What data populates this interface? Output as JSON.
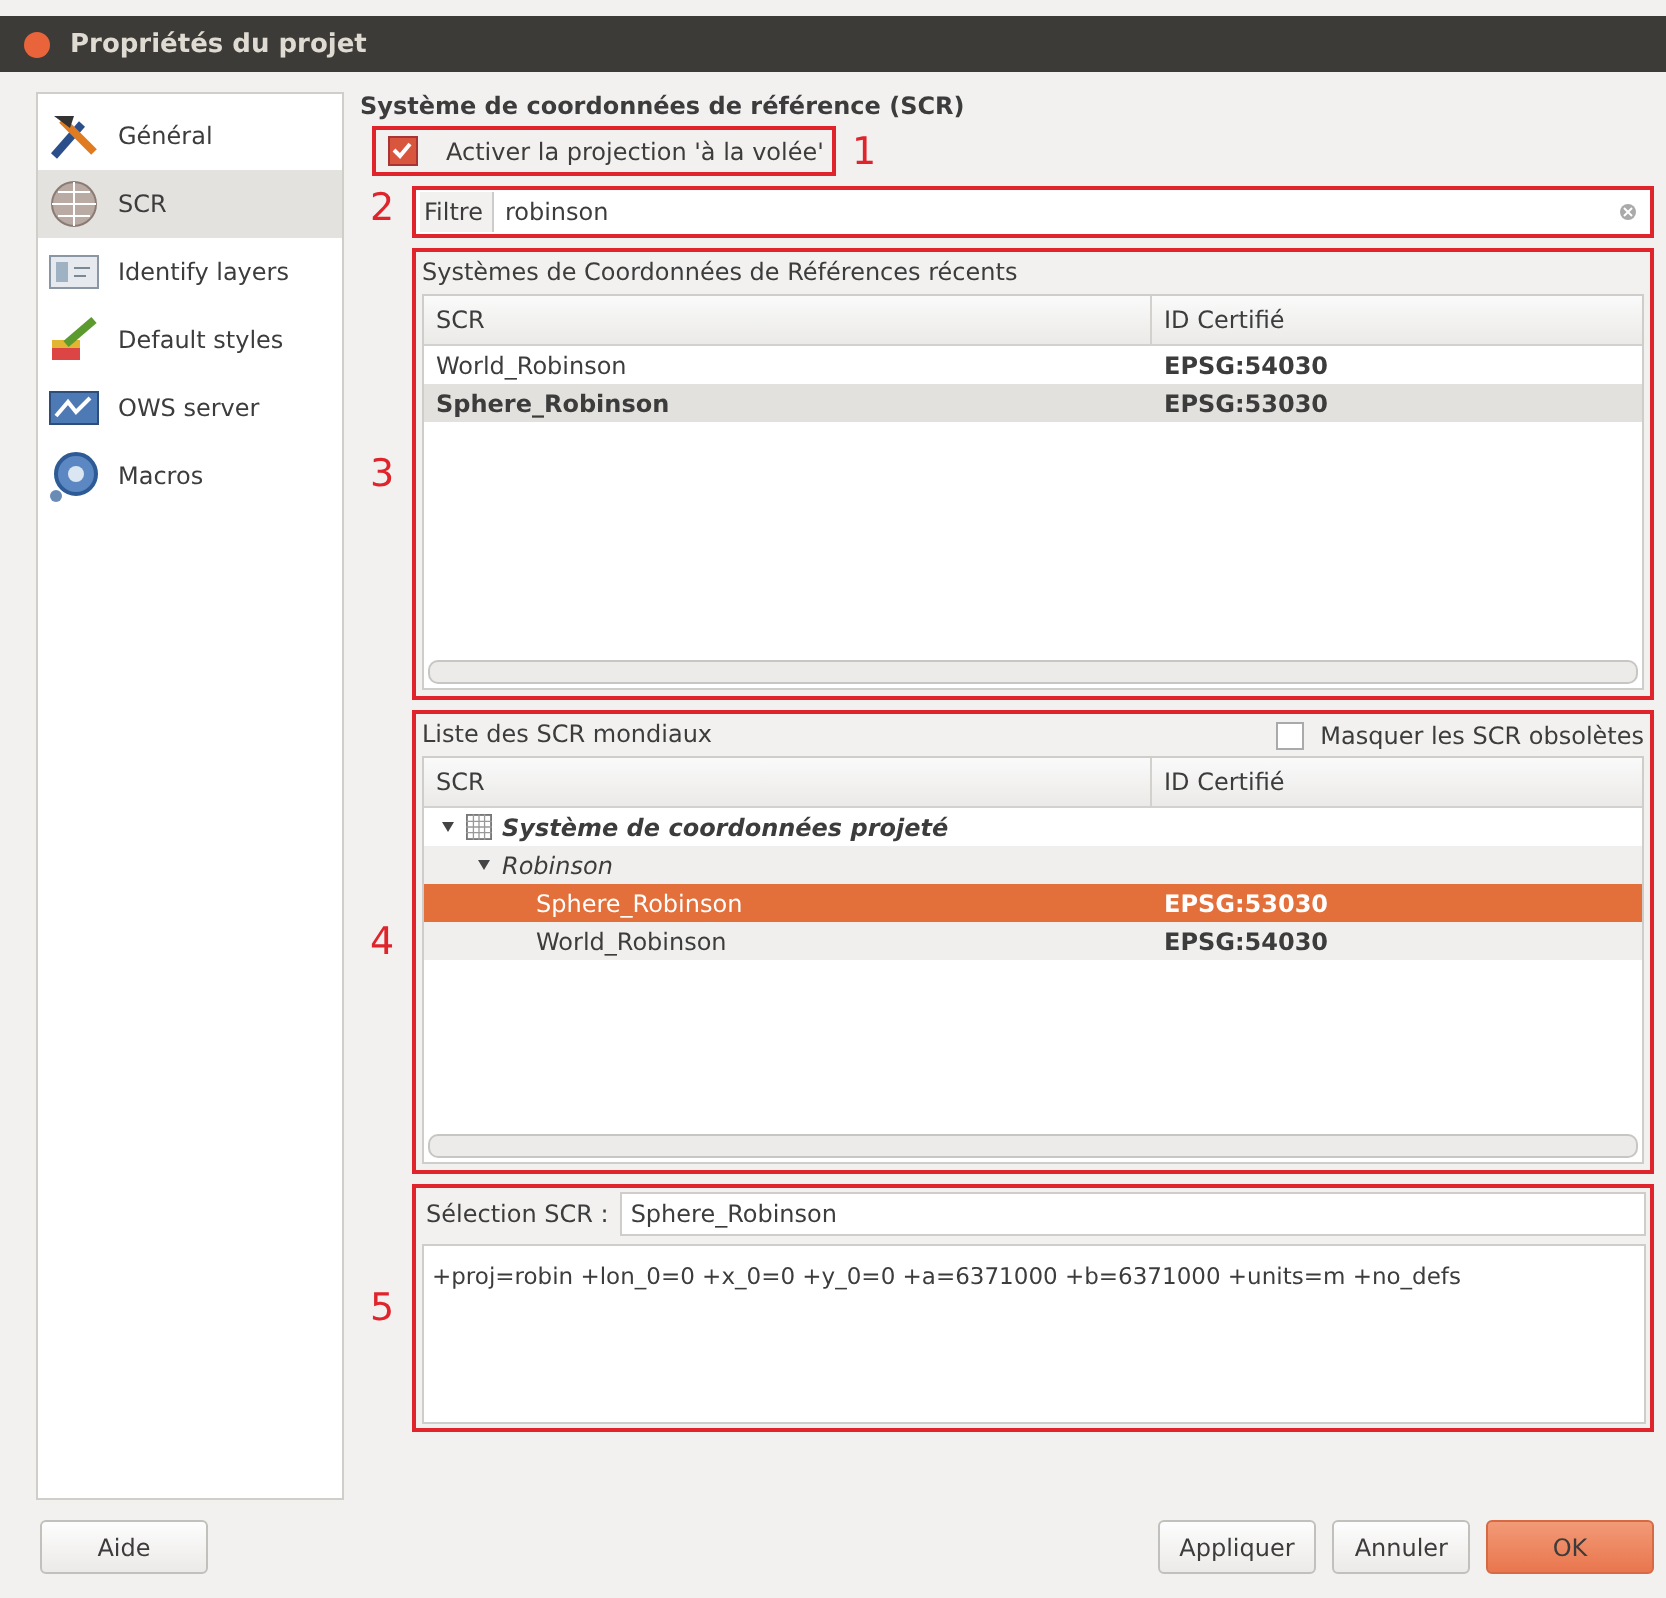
{
  "window": {
    "title": "Propriétés du projet"
  },
  "sidebar": {
    "items": [
      {
        "label": "Général",
        "selected": false
      },
      {
        "label": "SCR",
        "selected": true
      },
      {
        "label": "Identify layers",
        "selected": false
      },
      {
        "label": "Default styles",
        "selected": false
      },
      {
        "label": "OWS server",
        "selected": false
      },
      {
        "label": "Macros",
        "selected": false
      }
    ]
  },
  "section_title": "Système de coordonnées de référence (SCR)",
  "projection_checkbox": {
    "label": "Activer la projection 'à la volée'",
    "checked": true,
    "marker": "1"
  },
  "filter": {
    "label": "Filtre",
    "value": "robinson",
    "marker": "2"
  },
  "recent": {
    "marker": "3",
    "title": "Systèmes de Coordonnées de Références récents",
    "columns": [
      "SCR",
      "ID Certifié"
    ],
    "rows": [
      {
        "name": "World_Robinson",
        "id": "EPSG:54030",
        "selected": false
      },
      {
        "name": "Sphere_Robinson",
        "id": "EPSG:53030",
        "selected": true
      }
    ]
  },
  "world": {
    "marker": "4",
    "title": "Liste des SCR mondiaux",
    "hide_checkbox": {
      "label": "Masquer les SCR obsolètes",
      "checked": false
    },
    "columns": [
      "SCR",
      "ID Certifié"
    ],
    "tree": [
      {
        "name": "Système de coordonnées projeté",
        "expanded": true,
        "children": [
          {
            "name": "Robinson",
            "expanded": true,
            "children": [
              {
                "name": "Sphere_Robinson",
                "id": "EPSG:53030",
                "selected": true
              },
              {
                "name": "World_Robinson",
                "id": "EPSG:54030",
                "selected": false
              }
            ]
          }
        ]
      }
    ]
  },
  "selection": {
    "marker": "5",
    "label": "Sélection SCR :",
    "value": "Sphere_Robinson",
    "proj4": "+proj=robin +lon_0=0 +x_0=0 +y_0=0 +a=6371000 +b=6371000 +units=m +no_defs"
  },
  "buttons": {
    "help": "Aide",
    "actions": [
      {
        "label": "Appliquer",
        "kind": "normal"
      },
      {
        "label": "Annuler",
        "kind": "normal"
      },
      {
        "label": "OK",
        "kind": "default"
      }
    ]
  }
}
